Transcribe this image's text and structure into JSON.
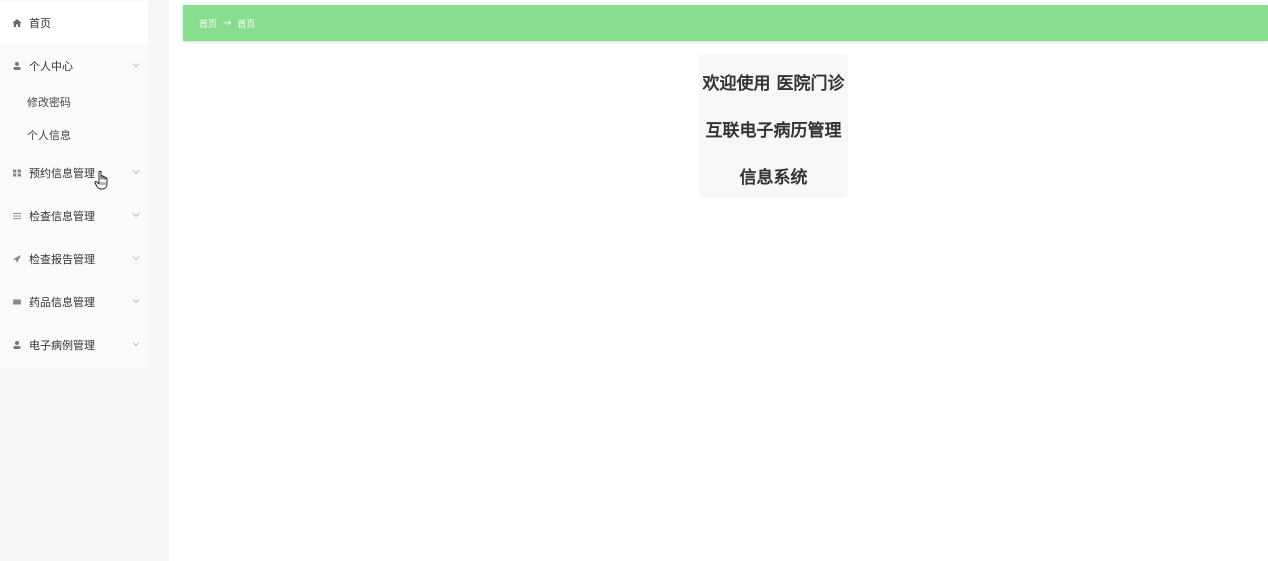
{
  "sidebar": {
    "home_label": "首页",
    "personal_center": {
      "label": "个人中心",
      "children": [
        "修改密码",
        "个人信息"
      ]
    },
    "items": [
      {
        "label": "预约信息管理",
        "icon": "grid-icon"
      },
      {
        "label": "检查信息管理",
        "icon": "list-icon"
      },
      {
        "label": "检查报告管理",
        "icon": "send-icon"
      },
      {
        "label": "药品信息管理",
        "icon": "ticket-icon"
      },
      {
        "label": "电子病例管理",
        "icon": "user-icon"
      }
    ]
  },
  "breadcrumb": {
    "first": "首页",
    "separator": "→",
    "current": "首页",
    "bar_color": "#88de8e"
  },
  "welcome": {
    "lines": [
      "欢迎使用 医院门诊",
      "互联电子病历管理",
      "信息系统"
    ]
  }
}
